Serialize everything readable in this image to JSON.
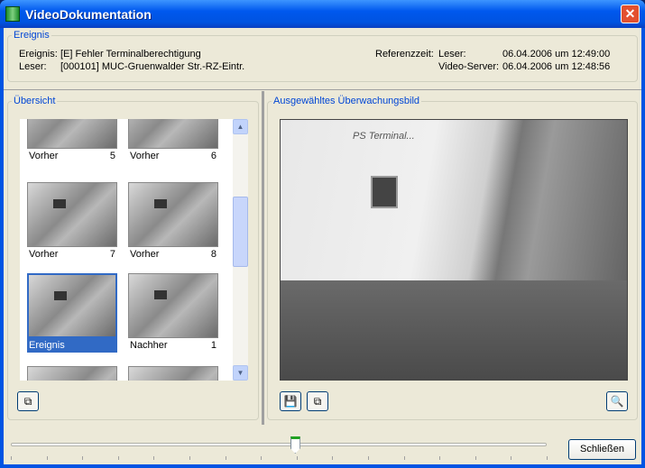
{
  "window": {
    "title": "VideoDokumentation",
    "close": "✕"
  },
  "event": {
    "legend": "Ereignis",
    "event_label": "Ereignis:",
    "event_value": "[E] Fehler Terminalberechtigung",
    "reader_label": "Leser:",
    "reader_value": "[000101] MUC-Gruenwalder Str.-RZ-Eintr.",
    "ref_label": "Referenzzeit:",
    "ref_reader_label": "Leser:",
    "ref_reader_value": "06.04.2006 um 12:49:00",
    "ref_server_label": "Video-Server:",
    "ref_server_value": "06.04.2006 um 12:48:56"
  },
  "overview": {
    "legend": "Übersicht",
    "thumbnails": [
      {
        "label": "Vorher",
        "num": "5"
      },
      {
        "label": "Vorher",
        "num": "6"
      },
      {
        "label": "Vorher",
        "num": "7"
      },
      {
        "label": "Vorher",
        "num": "8"
      },
      {
        "label": "Ereignis",
        "num": "",
        "selected": true
      },
      {
        "label": "Nachher",
        "num": "1"
      }
    ]
  },
  "selected": {
    "legend": "Ausgewähltes Überwachungsbild",
    "sign_text": "PS Terminal..."
  },
  "timeline": {
    "position": 0.53,
    "ticks": 16
  },
  "buttons": {
    "close": "Schließen"
  }
}
